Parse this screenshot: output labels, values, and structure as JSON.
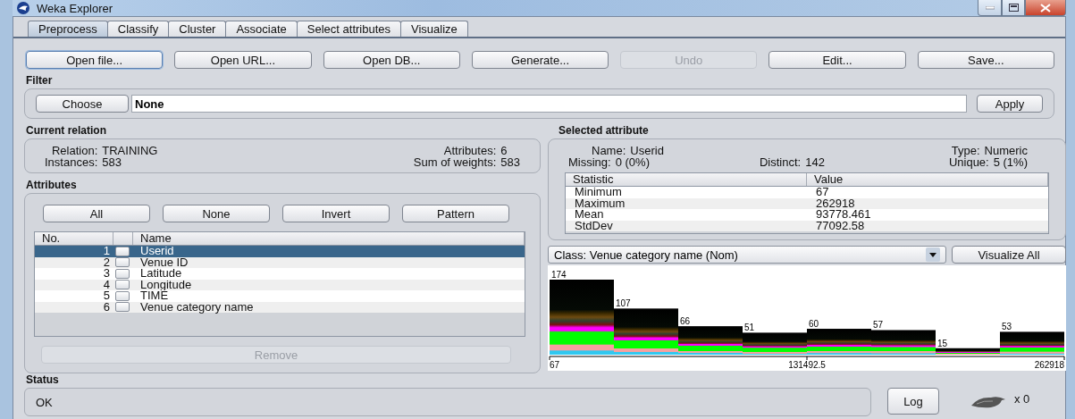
{
  "window": {
    "title": "Weka Explorer"
  },
  "tabs": [
    {
      "label": "Preprocess",
      "selected": true
    },
    {
      "label": "Classify",
      "selected": false
    },
    {
      "label": "Cluster",
      "selected": false
    },
    {
      "label": "Associate",
      "selected": false
    },
    {
      "label": "Select attributes",
      "selected": false
    },
    {
      "label": "Visualize",
      "selected": false
    }
  ],
  "toolbar": [
    {
      "label": "Open file...",
      "disabled": false,
      "focused": true
    },
    {
      "label": "Open URL...",
      "disabled": false,
      "focused": false
    },
    {
      "label": "Open DB...",
      "disabled": false,
      "focused": false
    },
    {
      "label": "Generate...",
      "disabled": false,
      "focused": false
    },
    {
      "label": "Undo",
      "disabled": true,
      "focused": false
    },
    {
      "label": "Edit...",
      "disabled": false,
      "focused": false
    },
    {
      "label": "Save...",
      "disabled": false,
      "focused": false
    }
  ],
  "filter": {
    "title": "Filter",
    "choose_button": "Choose",
    "value": "None",
    "apply_button": "Apply"
  },
  "current_relation": {
    "title": "Current relation",
    "fields": [
      {
        "label": "Relation:",
        "value": "TRAINING"
      },
      {
        "label": "Attributes:",
        "value": "6"
      },
      {
        "label": "Instances:",
        "value": "583"
      },
      {
        "label": "Sum of weights:",
        "value": "583"
      }
    ]
  },
  "attributes": {
    "title": "Attributes",
    "buttons": [
      "All",
      "None",
      "Invert",
      "Pattern"
    ],
    "columns": [
      "No.",
      "Name"
    ],
    "rows": [
      {
        "no": "1",
        "name": "Userid",
        "checked": false,
        "selected": true
      },
      {
        "no": "2",
        "name": "Venue ID",
        "checked": false,
        "selected": false
      },
      {
        "no": "3",
        "name": "Latitude",
        "checked": false,
        "selected": false
      },
      {
        "no": "4",
        "name": "Longitude",
        "checked": false,
        "selected": false
      },
      {
        "no": "5",
        "name": "TIME",
        "checked": false,
        "selected": false
      },
      {
        "no": "6",
        "name": "Venue category name",
        "checked": false,
        "selected": false
      }
    ],
    "remove_button": {
      "label": "Remove",
      "disabled": true
    }
  },
  "selected_attribute": {
    "title": "Selected attribute",
    "field_rows": [
      [
        {
          "label": "Name:",
          "value": "Userid"
        },
        {
          "label": "Type:",
          "value": "Numeric"
        }
      ],
      [
        {
          "label": "Missing:",
          "value": "0 (0%)"
        },
        {
          "label": "Distinct:",
          "value": "142"
        },
        {
          "label": "Unique:",
          "value": "5 (1%)"
        }
      ]
    ],
    "columns": [
      "Statistic",
      "Value"
    ],
    "rows": [
      [
        "Minimum",
        "67"
      ],
      [
        "Maximum",
        "262918"
      ],
      [
        "Mean",
        "93778.461"
      ],
      [
        "StdDev",
        "77092.58"
      ]
    ]
  },
  "class_selector": {
    "value": "Class: Venue category name  (Nom)"
  },
  "visualize_button": "Visualize All",
  "histogram": {
    "bar_labels": [
      "174",
      "107",
      "66",
      "51",
      "60",
      "57",
      "15",
      "53"
    ],
    "axis_labels": [
      "67",
      "131492.5",
      "262918"
    ]
  },
  "status": {
    "title": "Status",
    "message": "OK",
    "log_button": "Log",
    "count": "x 0"
  }
}
